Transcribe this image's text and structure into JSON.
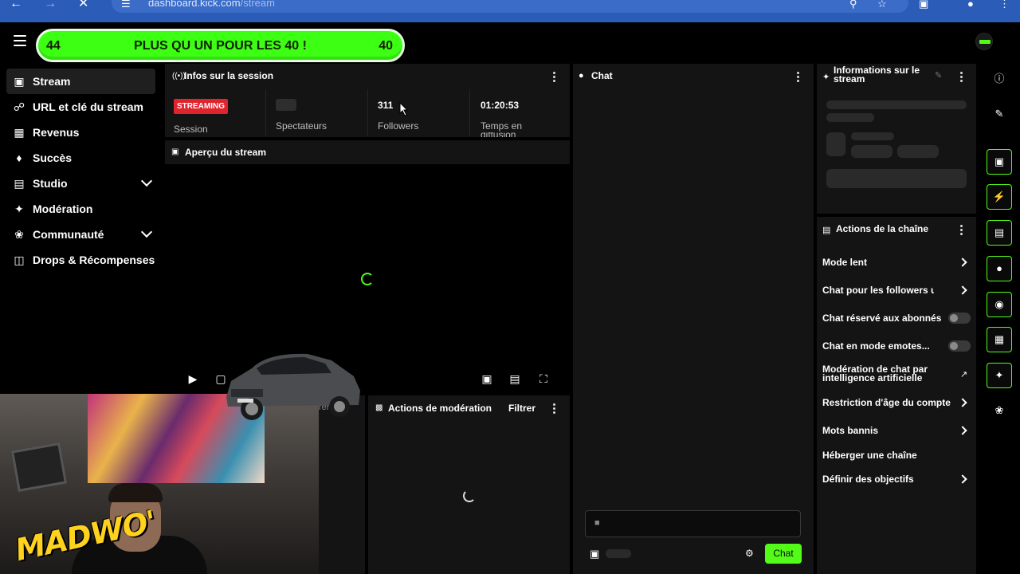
{
  "browser": {
    "url_host": "dashboard.kick.com",
    "url_path": "/stream"
  },
  "goal": {
    "left_number": "44",
    "text": "PLUS QU UN POUR LES 40 !",
    "right_number": "40",
    "color": "#3cff14"
  },
  "sidebar": {
    "items": [
      {
        "label": "Stream",
        "icon": "broadcast-icon"
      },
      {
        "label": "URL et clé du stream",
        "icon": "link-icon"
      },
      {
        "label": "Revenus",
        "icon": "chart-icon"
      },
      {
        "label": "Succès",
        "icon": "trophy-icon"
      },
      {
        "label": "Studio",
        "icon": "studio-icon"
      },
      {
        "label": "Modération",
        "icon": "wrench-icon"
      },
      {
        "label": "Communauté",
        "icon": "community-icon"
      },
      {
        "label": "Drops & Récompenses",
        "icon": "gift-icon"
      }
    ]
  },
  "session": {
    "title": "Infos sur la session",
    "badge": "STREAMING",
    "session_label": "Session",
    "viewers_label": "Spectateurs",
    "followers_value": "311",
    "followers_label": "Followers",
    "time_value": "01:20:53",
    "time_label": "Temps en",
    "time_label_2": "diffusion"
  },
  "preview": {
    "title": "Aperçu du stream"
  },
  "moderation": {
    "title": "Actions de modération",
    "filter": "Filtrer",
    "partial_text": "rer"
  },
  "chat": {
    "title": "Chat",
    "send_label": "Chat"
  },
  "info": {
    "title": "Informations sur le stream"
  },
  "channel_actions": {
    "title": "Actions de la chaîne",
    "items": [
      {
        "label": "Mode lent",
        "control": "chevron"
      },
      {
        "label": "Chat pour les followers uniquement",
        "control": "chevron"
      },
      {
        "label": "Chat réservé aux abonnés",
        "control": "toggle"
      },
      {
        "label": "Chat en mode emotes...",
        "control": "toggle"
      },
      {
        "label": "Modération de chat par intelligence artificielle",
        "control": "external"
      },
      {
        "label": "Restriction d'âge du compte",
        "control": "chevron"
      },
      {
        "label": "Mots bannis",
        "control": "chevron"
      },
      {
        "label": "Héberger une chaîne",
        "control": "none"
      },
      {
        "label": "Définir des objectifs",
        "control": "chevron"
      }
    ]
  },
  "overlay": {
    "logo_text": "MADWO'"
  },
  "colors": {
    "accent": "#53fc18",
    "badge_red": "#e0242e",
    "panel": "#141414"
  }
}
